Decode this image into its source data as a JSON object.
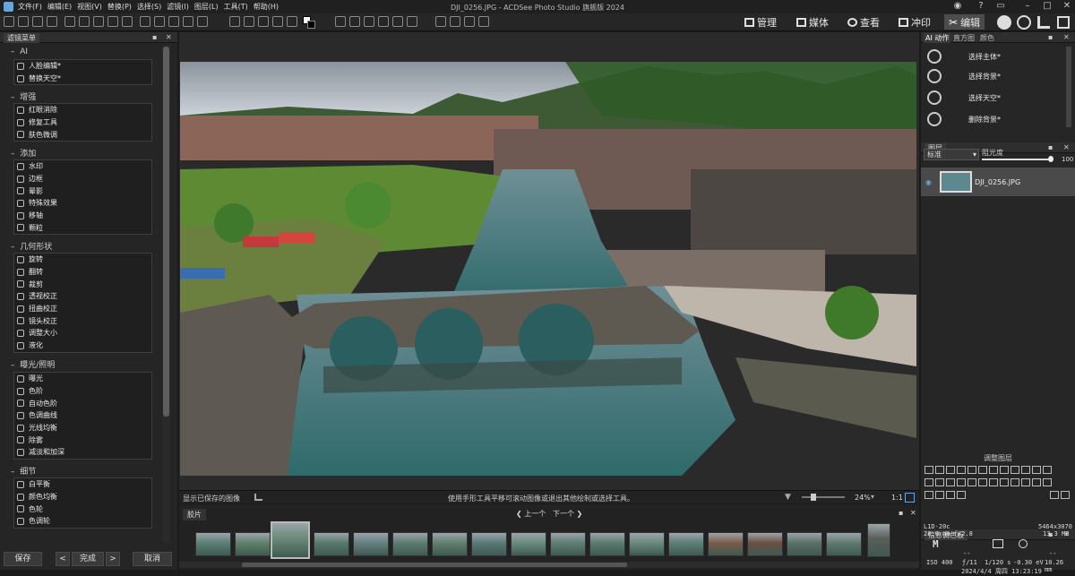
{
  "app": {
    "title": "DJI_0256.JPG - ACDSee Photo Studio 旗舰版 2024",
    "menu": [
      "文件(F)",
      "编辑(E)",
      "视图(V)",
      "替换(P)",
      "选择(S)",
      "滤镜(I)",
      "图层(L)",
      "工具(T)",
      "帮助(H)"
    ]
  },
  "modes": [
    {
      "label": "管理",
      "icon": "grid-icon",
      "active": false
    },
    {
      "label": "媒体",
      "icon": "media-icon",
      "active": false
    },
    {
      "label": "查看",
      "icon": "eye-icon",
      "active": false
    },
    {
      "label": "冲印",
      "icon": "develop-icon",
      "active": false
    },
    {
      "label": "编辑",
      "icon": "edit-icon",
      "active": true
    }
  ],
  "left_panel": {
    "tab": "滤镜菜单",
    "sections": [
      {
        "title": "AI",
        "items": [
          "人脸编辑*",
          "替换天空*"
        ]
      },
      {
        "title": "增强",
        "items": [
          "红眼消除",
          "修复工具",
          "肤色微调"
        ]
      },
      {
        "title": "添加",
        "items": [
          "水印",
          "边框",
          "晕影",
          "特殊效果",
          "移轴",
          "颗粒"
        ]
      },
      {
        "title": "几何形状",
        "items": [
          "旋转",
          "翻转",
          "裁剪",
          "透视校正",
          "扭曲校正",
          "镜头校正",
          "调整大小",
          "液化"
        ]
      },
      {
        "title": "曝光/照明",
        "items": [
          "曝光",
          "色阶",
          "自动色阶",
          "色调曲线",
          "光线均衡",
          "除雾",
          "减淡和加深"
        ]
      },
      {
        "title": "细节",
        "items": [
          "白平衡",
          "颜色均衡",
          "色轮",
          "色调轮"
        ]
      }
    ],
    "buttons": {
      "save": "保存",
      "prev": "<",
      "done": "完成",
      "next": ">",
      "cancel": "取消"
    }
  },
  "viewer": {
    "status_left": "显示已保存的图像",
    "status_hint": "使用手形工具平移可滚动图像或退出其他绘制或选择工具。",
    "zoom": "24%",
    "ratio": "1:1"
  },
  "filmstrip": {
    "tab": "胶片",
    "prev": "上一个",
    "next": "下一个",
    "selected_index": 2
  },
  "right_panel": {
    "tabs": [
      "AI 动作",
      "直方图",
      "颜色"
    ],
    "ai_actions": [
      "选择主体*",
      "选择背景*",
      "选择天空*",
      "删除背景*"
    ],
    "layers": {
      "tab": "图层",
      "blend": "标准",
      "opacity_label": "阻光度",
      "opacity_value": "100",
      "layer_name": "DJI_0256.JPG",
      "adjust_title": "调整图层"
    },
    "info": {
      "tab": "信息调色板",
      "camera": "L1D-20c",
      "lens": "28.0 mm f/2.8",
      "dimensions": "5464x3070",
      "size": "13.3 MB",
      "mode": "M",
      "iso": "ISO 400",
      "aperture": "ƒ/11",
      "shutter": "1/120 s",
      "ev": "-0.30 eV",
      "focal": "10.26 mm",
      "date": "2024/4/4 周四 13:23:19",
      "dashes": "--"
    }
  },
  "colors": {
    "accent": "#3d6ea8",
    "active_mode": "#4c4c4c"
  }
}
